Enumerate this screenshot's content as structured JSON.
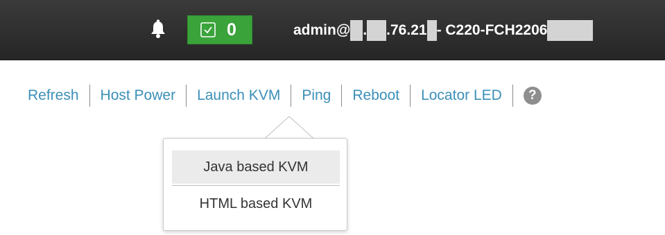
{
  "header": {
    "alert_count": "0",
    "user_prefix": "admin@",
    "user_ip_dot": ".",
    "user_ip_suffix": ".76.21",
    "user_server": " - C220-FCH2206"
  },
  "toolbar": {
    "items": [
      {
        "label": "Refresh"
      },
      {
        "label": "Host Power"
      },
      {
        "label": "Launch KVM"
      },
      {
        "label": "Ping"
      },
      {
        "label": "Reboot"
      },
      {
        "label": "Locator LED"
      }
    ],
    "help_label": "?"
  },
  "kvm_menu": {
    "items": [
      {
        "label": "Java based KVM",
        "highlighted": true
      },
      {
        "label": "HTML based KVM",
        "highlighted": false
      }
    ]
  },
  "colors": {
    "header_bg": "#2d2d2d",
    "alert_badge": "#3aa33a",
    "link": "#3b8fb8",
    "menu_highlight": "#ebebeb"
  },
  "icons": {
    "bell": "bell-icon",
    "check": "checkbox-check-icon",
    "help": "help-icon"
  }
}
